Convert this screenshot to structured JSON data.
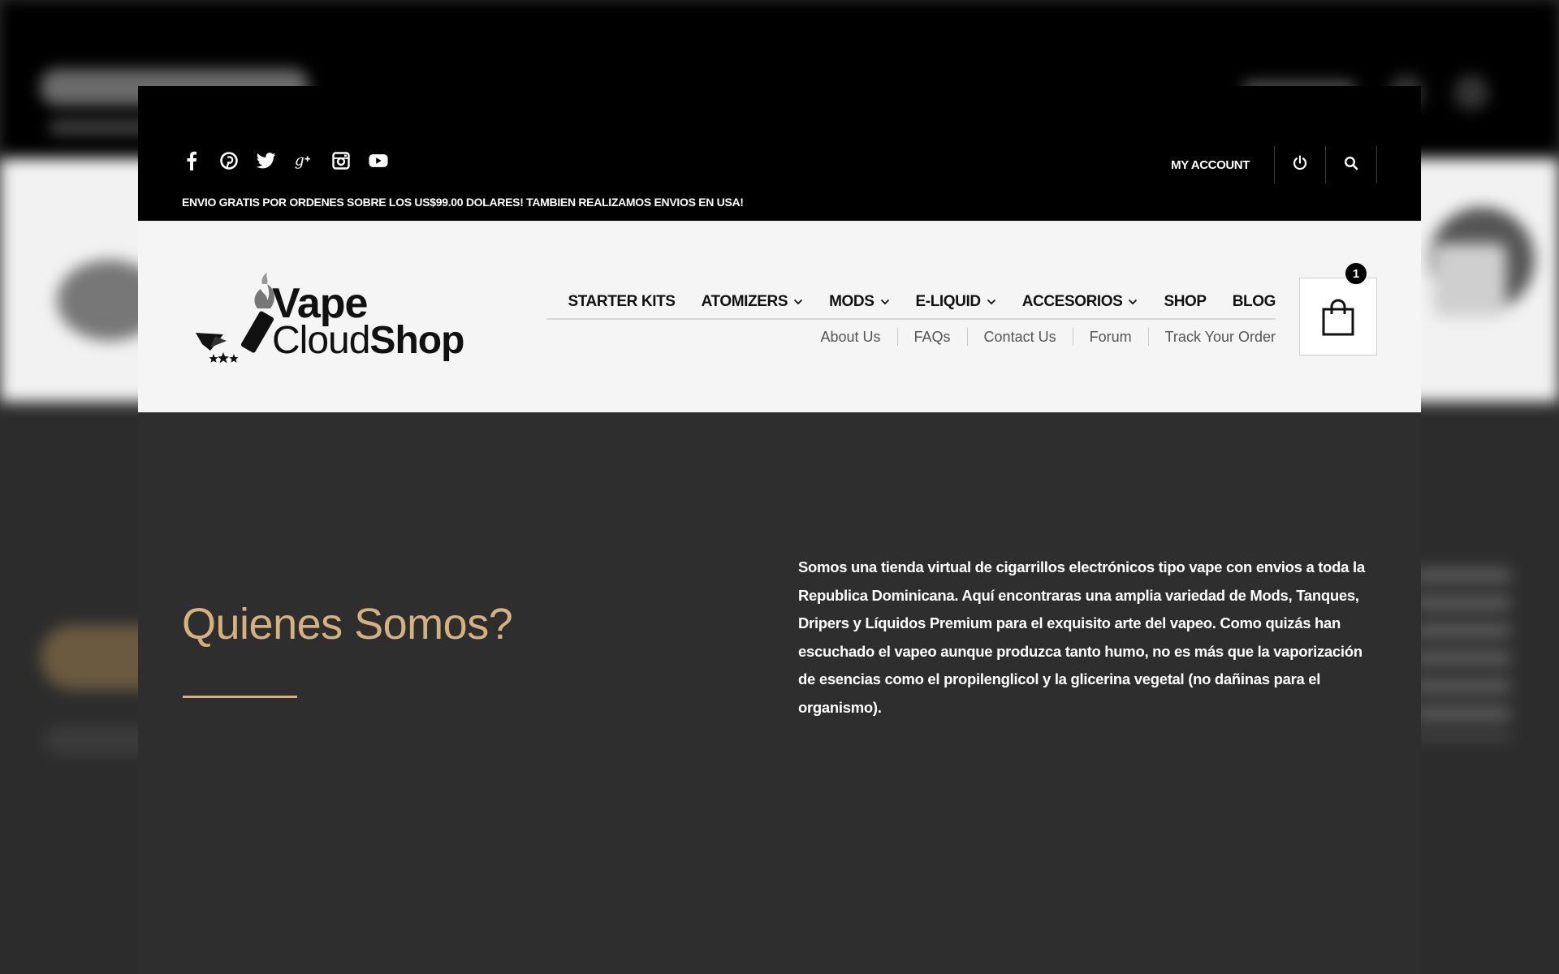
{
  "topbar": {
    "social_icons": [
      "facebook-icon",
      "pinterest-icon",
      "twitter-icon",
      "google-plus-icon",
      "instagram-icon",
      "youtube-icon"
    ],
    "shipping_notice": "ENVIO GRATIS POR ORDENES SOBRE LOS US$99.00 DOLARES! TAMBIEN REALIZAMOS ENVIOS EN USA!",
    "my_account": "MY ACCOUNT",
    "power_icon": "power-icon",
    "search_icon": "search-icon"
  },
  "logo": {
    "line1": "Vape",
    "line2_light": "Cloud",
    "line2_bold": "Shop"
  },
  "nav": {
    "items": [
      {
        "label": "STARTER KITS",
        "dropdown": false
      },
      {
        "label": "ATOMIZERS",
        "dropdown": true
      },
      {
        "label": "MODS",
        "dropdown": true
      },
      {
        "label": "E-LIQUID",
        "dropdown": true
      },
      {
        "label": "ACCESORIOS",
        "dropdown": true
      },
      {
        "label": "SHOP",
        "dropdown": false
      },
      {
        "label": "BLOG",
        "dropdown": false
      }
    ]
  },
  "subnav": {
    "items": [
      "About Us",
      "FAQs",
      "Contact Us",
      "Forum",
      "Track Your Order"
    ]
  },
  "cart": {
    "count": "1",
    "icon": "shopping-bag-icon"
  },
  "content": {
    "heading": "Quienes Somos?",
    "paragraph": "Somos una tienda virtual de cigarrillos electrónicos tipo vape con envios a toda la Republica Dominicana. Aquí encontraras una amplia variedad de Mods, Tanques, Dripers y Líquidos Premium para el exquisito arte del vapeo. Como quizás han escuchado el vapeo aunque produzca tanto humo, no es más que la vaporización de esencias como el propilenglicol y la glicerina vegetal (no dañinas para el organismo)."
  },
  "colors": {
    "accent_gold": "#d4b17e",
    "topbar_bg": "#000000",
    "header_bg": "#f5f5f5",
    "content_bg": "#2e2e2e"
  }
}
